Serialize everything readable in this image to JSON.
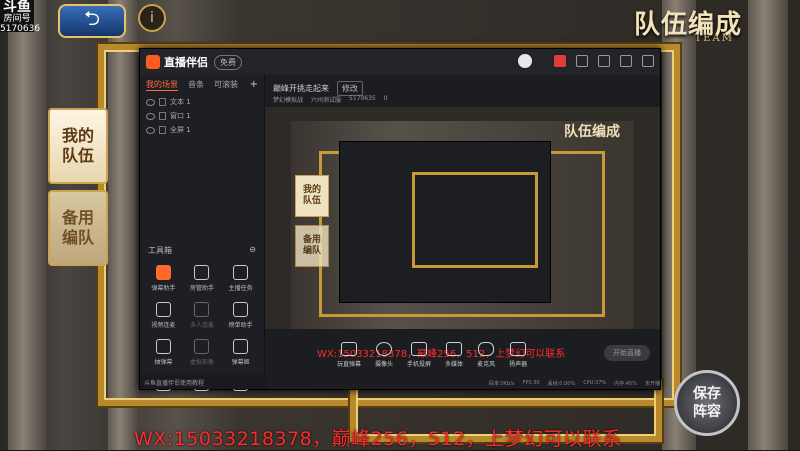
{
  "brand": {
    "logo": "斗鱼",
    "sub": "房间号",
    "room_id": "5170636"
  },
  "game": {
    "back_icon": "back-arrow-icon",
    "info_icon": "info-icon",
    "title": "队伍编成",
    "title_sub": "TEAM",
    "tab_my_team": "我的\n队伍",
    "tab_backup": "备用\n编队",
    "badge": "保存\n阵容"
  },
  "watermark": "WX:15033218378，巅峰256，512，上梦幻可以联系",
  "app": {
    "name": "直播伴侣",
    "chip": "免费",
    "room_title": "巅峰开挑走起来",
    "edit_label": "修改",
    "category": "梦幻模拟战",
    "category2": "六州测试服",
    "room_id": "5170635",
    "heat": "0",
    "tabs": [
      "我的场景",
      "音条",
      "可滚装"
    ],
    "layers": [
      {
        "name": "文本 1"
      },
      {
        "name": "窗口 1"
      },
      {
        "name": "全屏 1"
      }
    ],
    "tools_title": "工具箱",
    "tools": [
      {
        "label": "弹幕助手",
        "state": "highlight"
      },
      {
        "label": "房管助手",
        "state": "normal"
      },
      {
        "label": "主播任务",
        "state": "normal"
      },
      {
        "label": "视频连麦",
        "state": "normal"
      },
      {
        "label": "多人连麦",
        "state": "dim"
      },
      {
        "label": "榜单助手",
        "state": "normal"
      },
      {
        "label": "抽弹幕",
        "state": "normal"
      },
      {
        "label": "虚拟形象",
        "state": "dim"
      },
      {
        "label": "弹幕姬",
        "state": "normal"
      },
      {
        "label": "",
        "state": "normal"
      },
      {
        "label": "",
        "state": "normal"
      },
      {
        "label": "",
        "state": "normal"
      }
    ],
    "bottom_tip": "斗鱼直播伴侣使用教程",
    "controls": [
      {
        "label": "玩直弹幕"
      },
      {
        "label": "摄像头"
      },
      {
        "label": "手机投屏"
      },
      {
        "label": "多媒体"
      },
      {
        "label": "麦克风"
      },
      {
        "label": "扬声器"
      }
    ],
    "start_label": "开始直播",
    "status": [
      "码率:0Kb/s",
      "FPS:30",
      "丢帧:0.00%",
      "CPU:37%",
      "内存:45%",
      "未开播"
    ],
    "preview_title": "队伍编成",
    "preview_tab1": "我的\n队伍",
    "preview_tab2": "备用\n编队",
    "preview_watermark": "WX:15033218378，巅峰256，512，上梦幻可以联系"
  },
  "colors": {
    "accent": "#ff6a2a",
    "watermark": "#ff2a2a",
    "gold": "#c79a38"
  }
}
